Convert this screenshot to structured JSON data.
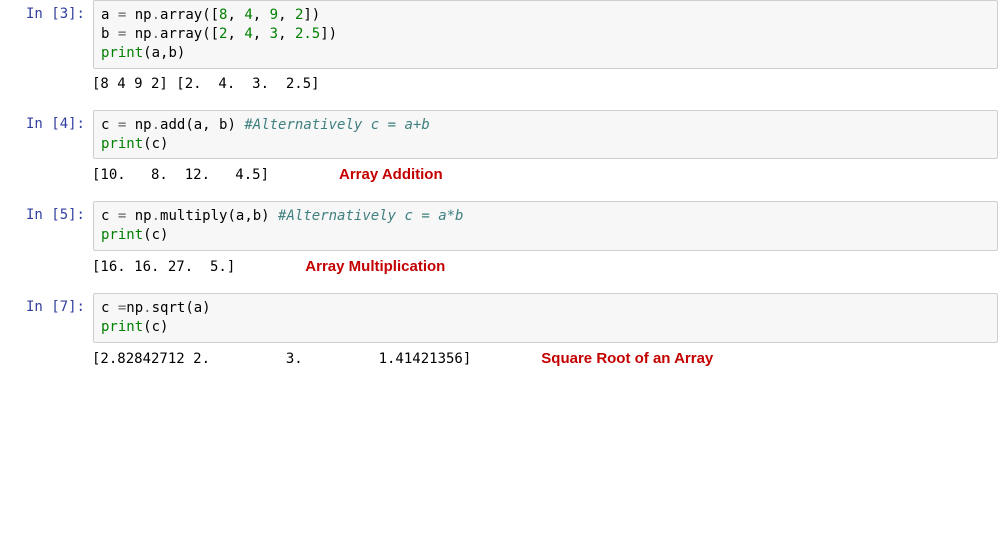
{
  "cells": [
    {
      "prompt": "In [3]:",
      "code_tokens": [
        {
          "t": "a ",
          "c": "n"
        },
        {
          "t": "=",
          "c": "o"
        },
        {
          "t": " np",
          "c": "n"
        },
        {
          "t": ".",
          "c": "o"
        },
        {
          "t": "array",
          "c": "n"
        },
        {
          "t": "([",
          "c": "p"
        },
        {
          "t": "8",
          "c": "mi"
        },
        {
          "t": ", ",
          "c": "p"
        },
        {
          "t": "4",
          "c": "mi"
        },
        {
          "t": ", ",
          "c": "p"
        },
        {
          "t": "9",
          "c": "mi"
        },
        {
          "t": ", ",
          "c": "p"
        },
        {
          "t": "2",
          "c": "mi"
        },
        {
          "t": "])\n",
          "c": "p"
        },
        {
          "t": "b ",
          "c": "n"
        },
        {
          "t": "=",
          "c": "o"
        },
        {
          "t": " np",
          "c": "n"
        },
        {
          "t": ".",
          "c": "o"
        },
        {
          "t": "array",
          "c": "n"
        },
        {
          "t": "([",
          "c": "p"
        },
        {
          "t": "2",
          "c": "mi"
        },
        {
          "t": ", ",
          "c": "p"
        },
        {
          "t": "4",
          "c": "mi"
        },
        {
          "t": ", ",
          "c": "p"
        },
        {
          "t": "3",
          "c": "mi"
        },
        {
          "t": ", ",
          "c": "p"
        },
        {
          "t": "2.5",
          "c": "mf"
        },
        {
          "t": "])\n",
          "c": "p"
        },
        {
          "t": "print",
          "c": "nb"
        },
        {
          "t": "(a,b)",
          "c": "p"
        }
      ],
      "output": "[8 4 9 2] [2.  4.  3.  2.5]",
      "annotation": ""
    },
    {
      "prompt": "In [4]:",
      "code_tokens": [
        {
          "t": "c ",
          "c": "n"
        },
        {
          "t": "=",
          "c": "o"
        },
        {
          "t": " np",
          "c": "n"
        },
        {
          "t": ".",
          "c": "o"
        },
        {
          "t": "add",
          "c": "n"
        },
        {
          "t": "(a, b) ",
          "c": "p"
        },
        {
          "t": "#Alternatively c = a+b",
          "c": "c1"
        },
        {
          "t": "\n",
          "c": "p"
        },
        {
          "t": "print",
          "c": "nb"
        },
        {
          "t": "(c)",
          "c": "p"
        }
      ],
      "output": "[10.   8.  12.   4.5]",
      "annotation": "Array Addition"
    },
    {
      "prompt": "In [5]:",
      "code_tokens": [
        {
          "t": "c ",
          "c": "n"
        },
        {
          "t": "=",
          "c": "o"
        },
        {
          "t": " np",
          "c": "n"
        },
        {
          "t": ".",
          "c": "o"
        },
        {
          "t": "multiply",
          "c": "n"
        },
        {
          "t": "(a,b) ",
          "c": "p"
        },
        {
          "t": "#Alternatively c = a*b",
          "c": "c1"
        },
        {
          "t": "\n",
          "c": "p"
        },
        {
          "t": "print",
          "c": "nb"
        },
        {
          "t": "(c)",
          "c": "p"
        }
      ],
      "output": "[16. 16. 27.  5.]",
      "annotation": "Array Multiplication"
    },
    {
      "prompt": "In [7]:",
      "code_tokens": [
        {
          "t": "c ",
          "c": "n"
        },
        {
          "t": "=",
          "c": "o"
        },
        {
          "t": "np",
          "c": "n"
        },
        {
          "t": ".",
          "c": "o"
        },
        {
          "t": "sqrt",
          "c": "n"
        },
        {
          "t": "(a)\n",
          "c": "p"
        },
        {
          "t": "print",
          "c": "nb"
        },
        {
          "t": "(c)",
          "c": "p"
        }
      ],
      "output": "[2.82842712 2.         3.         1.41421356]",
      "annotation": "Square Root of an Array"
    }
  ]
}
